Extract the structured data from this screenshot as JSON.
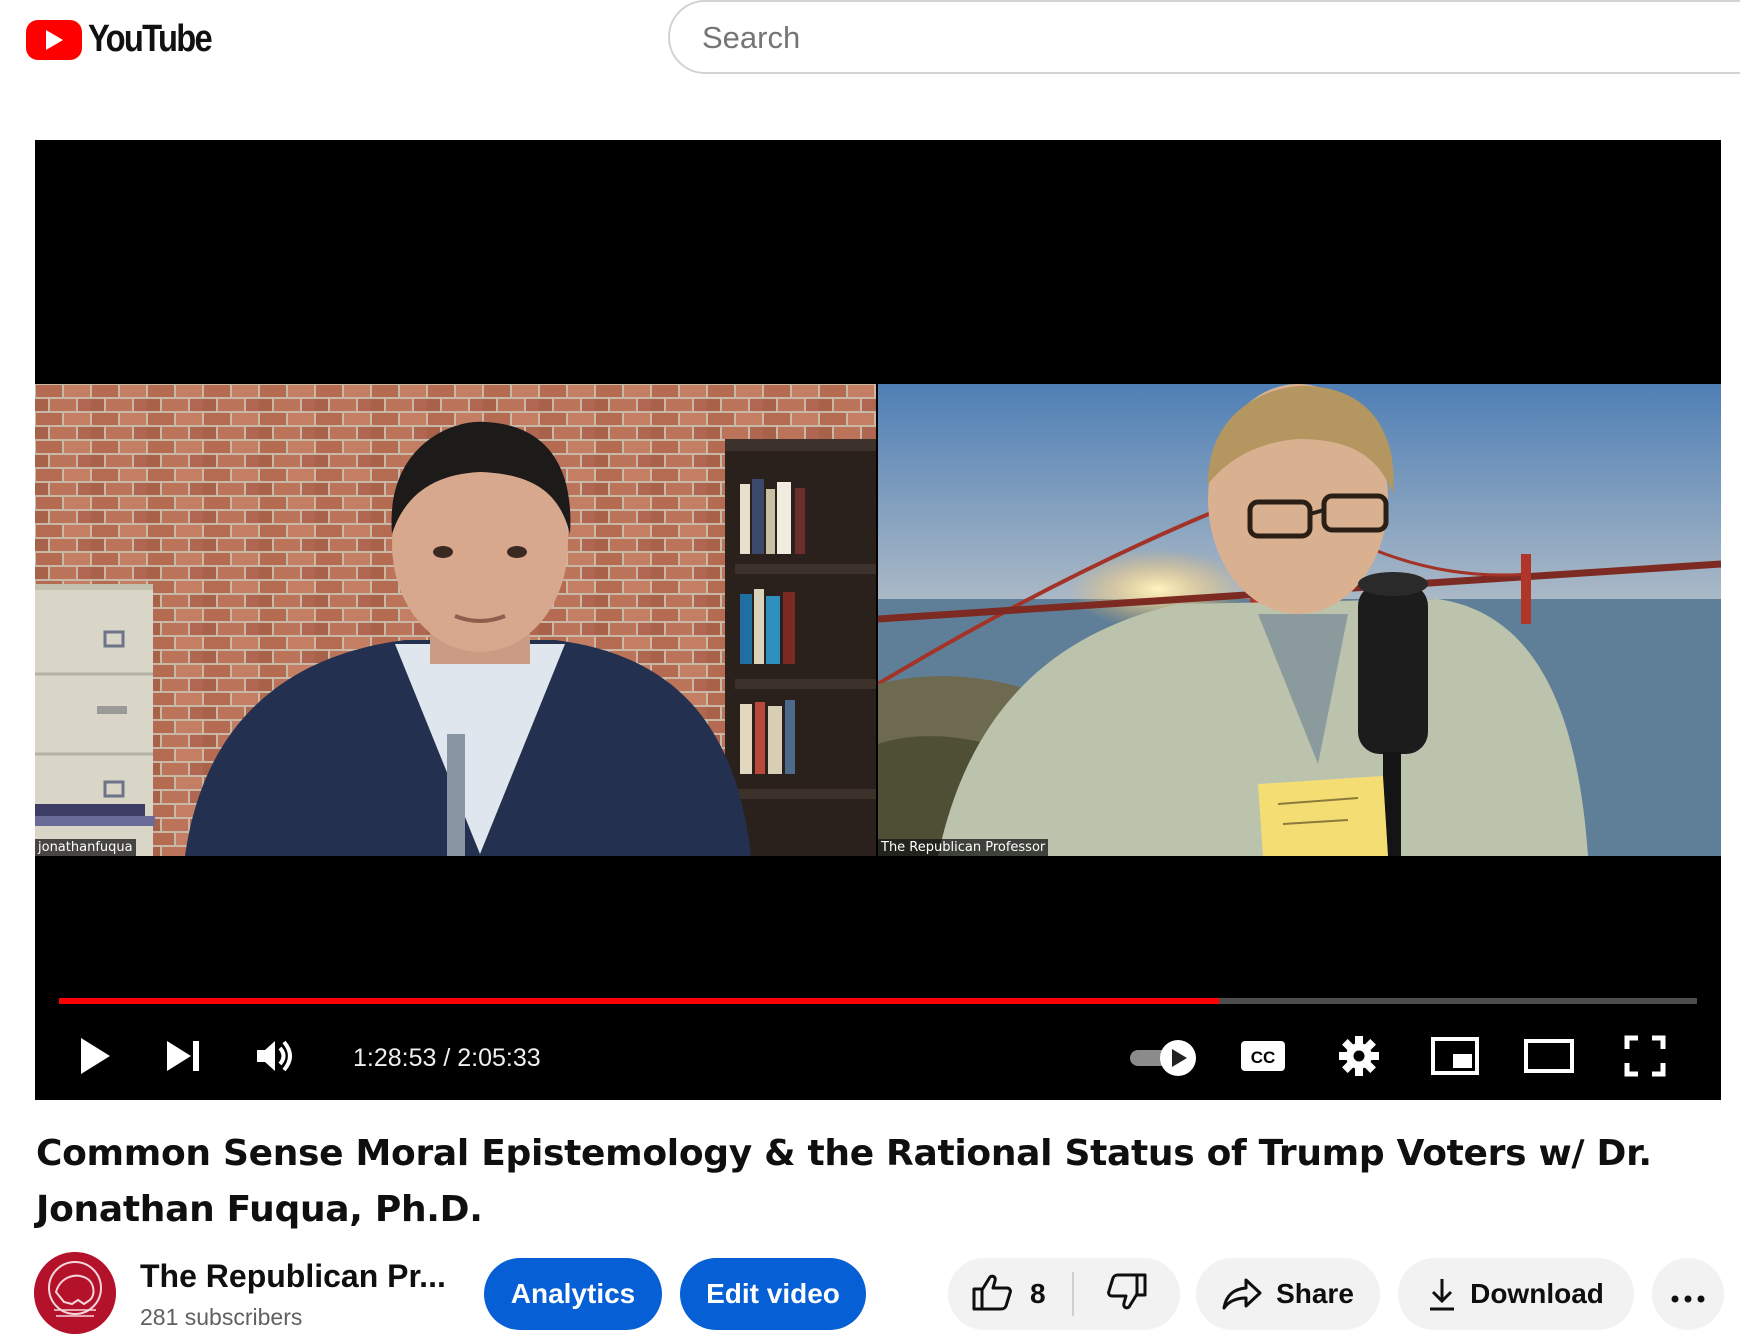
{
  "header": {
    "logo_text": "YouTube",
    "search_placeholder": "Search"
  },
  "player": {
    "time_current": "1:28:53",
    "time_separator": " / ",
    "time_total": "2:05:33",
    "progress_fraction": 0.708,
    "participants": [
      {
        "name": "jonathanfuqua"
      },
      {
        "name": "The Republican Professor"
      }
    ],
    "controls": [
      "play-icon",
      "next-icon",
      "volume-icon",
      "autoplay-toggle",
      "captions-icon",
      "settings-icon",
      "miniplayer-icon",
      "theater-icon",
      "fullscreen-icon"
    ]
  },
  "video": {
    "title": "Common Sense Moral Epistemology & the Rational Status of Trump Voters w/ Dr. Jonathan Fuqua, Ph.D."
  },
  "channel": {
    "name": "The Republican Pr...",
    "subscribers": "281 subscribers",
    "avatar_text": "The Republican Professor"
  },
  "actions": {
    "analytics_label": "Analytics",
    "edit_label": "Edit video",
    "like_count": "8",
    "share_label": "Share",
    "download_label": "Download",
    "more_icon": "more-horizontal-icon"
  },
  "colors": {
    "brand_red": "#ff0000",
    "action_blue": "#065fd4",
    "pill_grey": "#f2f2f2"
  }
}
